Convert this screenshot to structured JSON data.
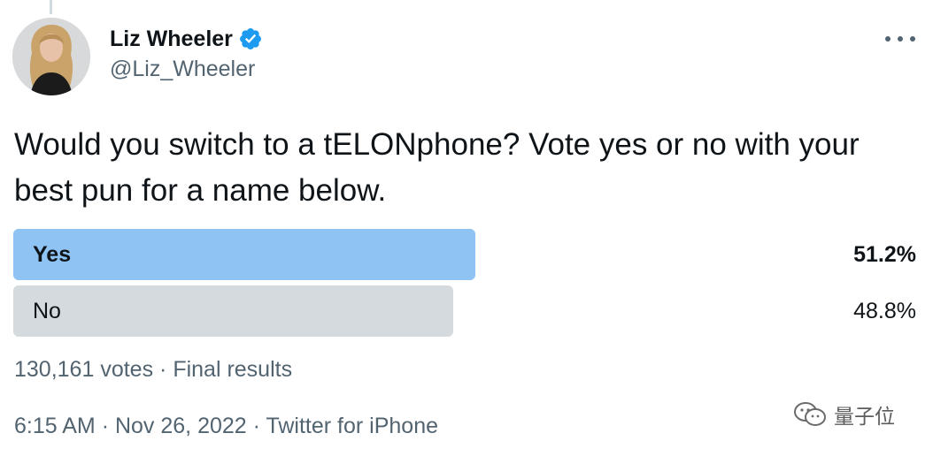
{
  "author": {
    "name": "Liz Wheeler",
    "handle": "@Liz_Wheeler",
    "verified": true
  },
  "tweet": {
    "text": "Would you switch to a tELONphone? Vote yes or no with your best pun for a name below."
  },
  "poll": {
    "options": [
      {
        "label": "Yes",
        "percent_text": "51.2%",
        "percent": 51.2,
        "winner": true
      },
      {
        "label": "No",
        "percent_text": "48.8%",
        "percent": 48.8,
        "winner": false
      }
    ],
    "votes": "130,161 votes",
    "separator": "·",
    "status": "Final results"
  },
  "meta": {
    "time": "6:15 AM",
    "date": "Nov 26, 2022",
    "source": "Twitter for iPhone",
    "separator": "·"
  },
  "watermark": {
    "text": "量子位"
  },
  "colors": {
    "winner_bar": "#8ec3f4",
    "loser_bar": "#d4dade",
    "verified": "#1d9bf0",
    "secondary_text": "#536471"
  },
  "icons": {
    "verified": "verified-badge-icon",
    "more": "more-dots-icon",
    "watermark": "wechat-logo-icon"
  }
}
